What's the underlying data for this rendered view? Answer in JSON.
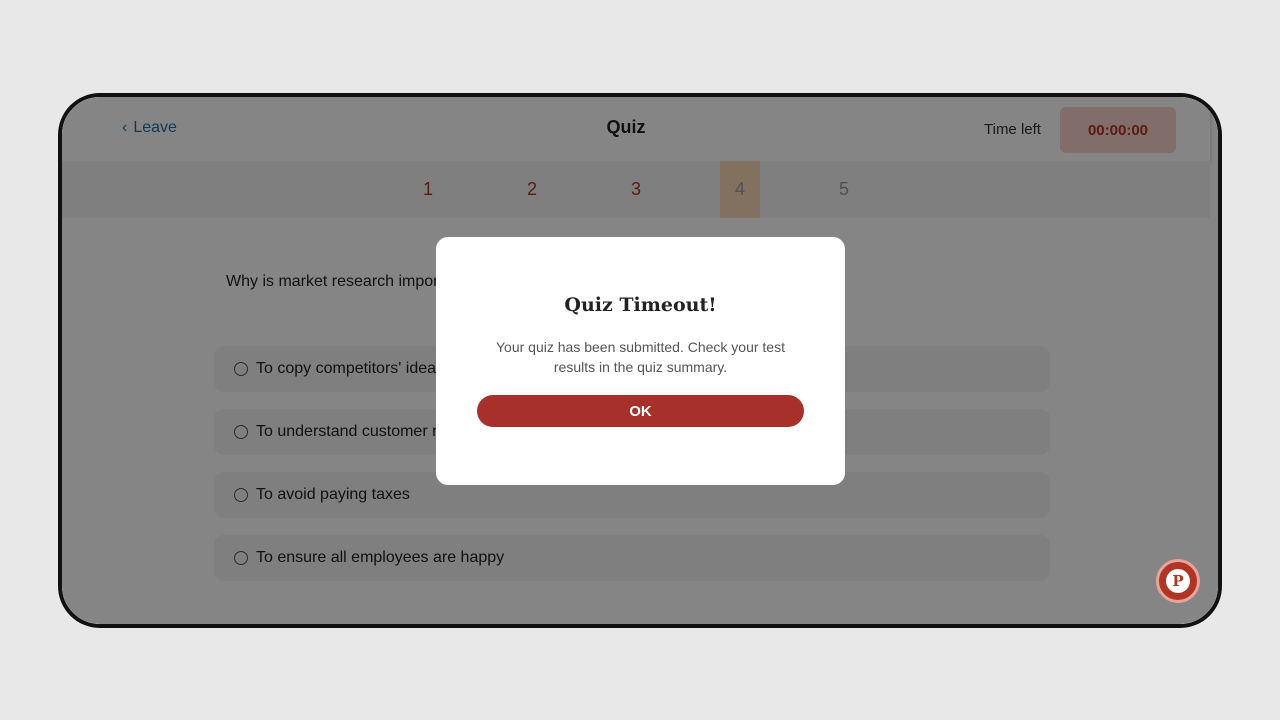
{
  "header": {
    "leave_label": "Leave",
    "title": "Quiz",
    "time_left_label": "Time left",
    "timer": "00:00:00"
  },
  "question_nav": [
    {
      "label": "1",
      "state": "answered"
    },
    {
      "label": "2",
      "state": "answered"
    },
    {
      "label": "3",
      "state": "answered"
    },
    {
      "label": "4",
      "state": "current"
    },
    {
      "label": "5",
      "state": "unanswered"
    }
  ],
  "question": {
    "text": "Why is market research important for a business?",
    "options": [
      "To copy competitors' ideas",
      "To understand customer needs and preferences",
      "To avoid paying taxes",
      "To ensure all employees are happy"
    ]
  },
  "modal": {
    "title": "Quiz Timeout!",
    "message": "Your quiz has been submitted. Check your test results in the quiz summary.",
    "ok_label": "OK"
  },
  "fab": {
    "icon": "p-logo-icon",
    "letter": "P"
  },
  "colors": {
    "accent": "#a8302a",
    "timer_bg": "#f7d2cb",
    "current_question_bg": "#fbd9b6",
    "link": "#1f6fae"
  }
}
